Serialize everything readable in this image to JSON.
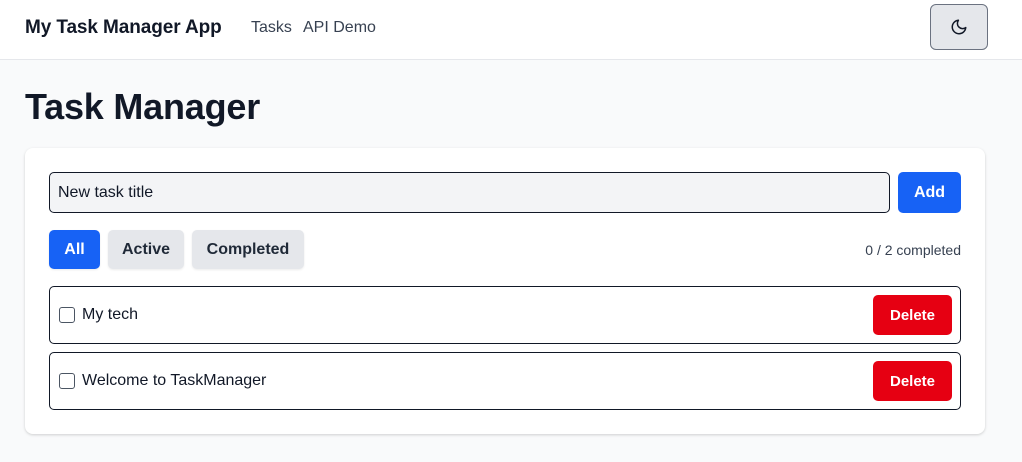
{
  "navbar": {
    "brand": "My Task Manager App",
    "links": [
      "Tasks",
      "API Demo"
    ],
    "theme_toggle_icon": "moon-icon"
  },
  "page": {
    "title": "Task Manager"
  },
  "new_task": {
    "placeholder": "New task title",
    "add_label": "Add"
  },
  "filters": {
    "all": "All",
    "active": "Active",
    "completed": "Completed",
    "selected": "All"
  },
  "progress": "0 / 2 completed",
  "tasks": [
    {
      "title": "My tech",
      "done": false,
      "delete_label": "Delete"
    },
    {
      "title": "Welcome to TaskManager",
      "done": false,
      "delete_label": "Delete"
    }
  ],
  "colors": {
    "primary": "#1762f5",
    "danger": "#e60012",
    "neutral_button": "#e5e7eb"
  }
}
